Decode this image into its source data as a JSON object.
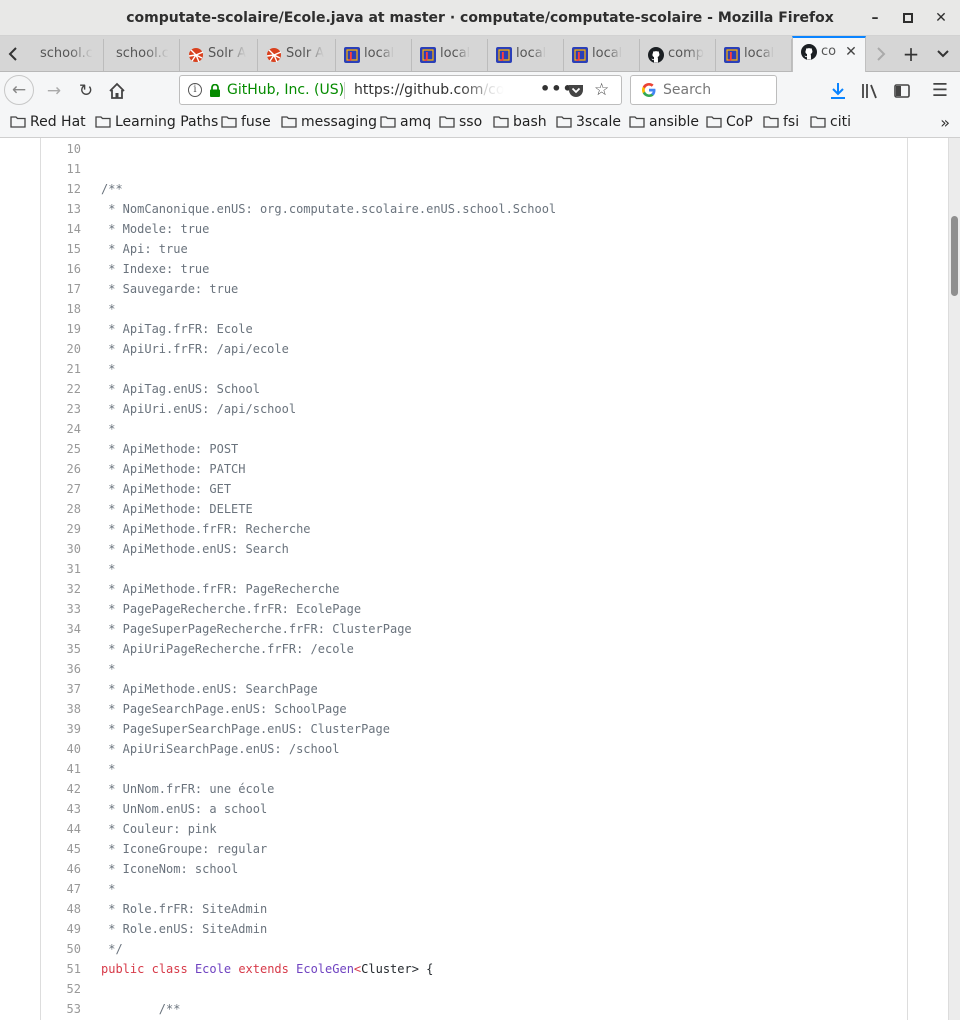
{
  "window": {
    "title": "computate-scolaire/Ecole.java at master · computate/computate-scolaire - Mozilla Firefox",
    "minimize": "–",
    "maximize": "□",
    "close": "✕"
  },
  "tabs": {
    "scroll_left": "‹",
    "scroll_right": "›",
    "new_tab": "+",
    "list": "⌄",
    "items": [
      {
        "label": "school.c",
        "icon": "no-icon"
      },
      {
        "label": "school.c",
        "icon": "no-icon"
      },
      {
        "label": "Solr A",
        "icon": "solr-icon"
      },
      {
        "label": "Solr A",
        "icon": "solr-icon"
      },
      {
        "label": "local",
        "icon": "jrebel-icon"
      },
      {
        "label": "local",
        "icon": "jrebel-icon"
      },
      {
        "label": "local",
        "icon": "jrebel-icon"
      },
      {
        "label": "local",
        "icon": "jrebel-icon"
      },
      {
        "label": "comp",
        "icon": "github-icon"
      },
      {
        "label": "local",
        "icon": "jrebel-icon"
      },
      {
        "label": "co",
        "icon": "github-icon",
        "active": true,
        "close": "✕"
      }
    ]
  },
  "nav": {
    "back": "←",
    "forward": "→",
    "reload": "↻",
    "home": "⌂",
    "identity_info": "i",
    "identity": "GitHub, Inc. (US)",
    "url_host": "https://github.com",
    "url_path": "/computate/computate-scolaire",
    "page_actions": "•••",
    "bookmark_star": "☆",
    "search_placeholder": "Search",
    "menu": "☰"
  },
  "bookmarks": {
    "items": [
      "Red Hat",
      "Learning Paths",
      "fuse",
      "messaging",
      "amq",
      "sso",
      "bash",
      "3scale",
      "ansible",
      "CoP",
      "fsi",
      "citi"
    ],
    "more": "»"
  },
  "code": {
    "lines": [
      {
        "n": "10",
        "t": ""
      },
      {
        "n": "11",
        "t": ""
      },
      {
        "n": "12",
        "t": "/**"
      },
      {
        "n": "13",
        "t": " * NomCanonique.enUS: org.computate.scolaire.enUS.school.School"
      },
      {
        "n": "14",
        "t": " * Modele: true"
      },
      {
        "n": "15",
        "t": " * Api: true"
      },
      {
        "n": "16",
        "t": " * Indexe: true"
      },
      {
        "n": "17",
        "t": " * Sauvegarde: true"
      },
      {
        "n": "18",
        "t": " *"
      },
      {
        "n": "19",
        "t": " * ApiTag.frFR: Ecole"
      },
      {
        "n": "20",
        "t": " * ApiUri.frFR: /api/ecole"
      },
      {
        "n": "21",
        "t": " *"
      },
      {
        "n": "22",
        "t": " * ApiTag.enUS: School"
      },
      {
        "n": "23",
        "t": " * ApiUri.enUS: /api/school"
      },
      {
        "n": "24",
        "t": " *"
      },
      {
        "n": "25",
        "t": " * ApiMethode: POST"
      },
      {
        "n": "26",
        "t": " * ApiMethode: PATCH"
      },
      {
        "n": "27",
        "t": " * ApiMethode: GET"
      },
      {
        "n": "28",
        "t": " * ApiMethode: DELETE"
      },
      {
        "n": "29",
        "t": " * ApiMethode.frFR: Recherche"
      },
      {
        "n": "30",
        "t": " * ApiMethode.enUS: Search"
      },
      {
        "n": "31",
        "t": " *"
      },
      {
        "n": "32",
        "t": " * ApiMethode.frFR: PageRecherche"
      },
      {
        "n": "33",
        "t": " * PagePageRecherche.frFR: EcolePage"
      },
      {
        "n": "34",
        "t": " * PageSuperPageRecherche.frFR: ClusterPage"
      },
      {
        "n": "35",
        "t": " * ApiUriPageRecherche.frFR: /ecole"
      },
      {
        "n": "36",
        "t": " *"
      },
      {
        "n": "37",
        "t": " * ApiMethode.enUS: SearchPage"
      },
      {
        "n": "38",
        "t": " * PageSearchPage.enUS: SchoolPage"
      },
      {
        "n": "39",
        "t": " * PageSuperSearchPage.enUS: ClusterPage"
      },
      {
        "n": "40",
        "t": " * ApiUriSearchPage.enUS: /school"
      },
      {
        "n": "41",
        "t": " *"
      },
      {
        "n": "42",
        "t": " * UnNom.frFR: une école"
      },
      {
        "n": "43",
        "t": " * UnNom.enUS: a school"
      },
      {
        "n": "44",
        "t": " * Couleur: pink"
      },
      {
        "n": "45",
        "t": " * IconeGroupe: regular"
      },
      {
        "n": "46",
        "t": " * IconeNom: school"
      },
      {
        "n": "47",
        "t": " *"
      },
      {
        "n": "48",
        "t": " * Role.frFR: SiteAdmin"
      },
      {
        "n": "49",
        "t": " * Role.enUS: SiteAdmin"
      },
      {
        "n": "50",
        "t": " */"
      },
      {
        "n": "51",
        "t": ""
      },
      {
        "n": "52",
        "t": ""
      },
      {
        "n": "53",
        "t": "        /**"
      }
    ],
    "class_decl": {
      "kw_public": "public",
      "kw_class": "class",
      "class_name": "Ecole",
      "kw_extends": "extends",
      "parent": "EcoleGen",
      "lt": "<",
      "type_arg": "Cluster",
      "tail": "> {"
    }
  },
  "colors": {
    "comment": "#6a737d",
    "keyword": "#d73a49",
    "entity": "#6f42c1",
    "secure_green": "#058b00",
    "active_tab_accent": "#0a84ff"
  }
}
